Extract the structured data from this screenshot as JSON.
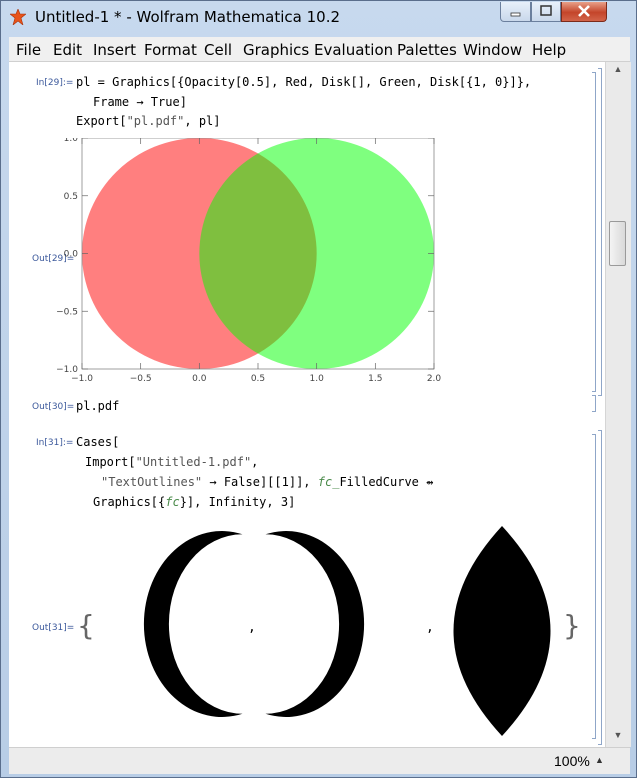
{
  "window": {
    "title": "Untitled-1 * - Wolfram Mathematica 10.2"
  },
  "menu": [
    "File",
    "Edit",
    "Insert",
    "Format",
    "Cell",
    "Graphics",
    "Evaluation",
    "Palettes",
    "Window",
    "Help"
  ],
  "cells": {
    "in29": {
      "label": "In[29]:=",
      "line1": "pl = Graphics[{Opacity[0.5], Red, Disk[], Green, Disk[{1, 0}]},",
      "line2": "Frame → True]",
      "line3_a": "Export[",
      "line3_str": "\"pl.pdf\"",
      "line3_b": ", pl]"
    },
    "out29": {
      "label": "Out[29]="
    },
    "out30": {
      "label": "Out[30]=",
      "value": "pl.pdf"
    },
    "in31": {
      "label": "In[31]:=",
      "line1": "Cases[",
      "line2_a": "Import[",
      "line2_str": "\"Untitled-1.pdf\"",
      "line2_b": ",",
      "line3_str": "\"TextOutlines\"",
      "line3_b": " → False][[1]], ",
      "line3_pat": "fc_",
      "line3_c": "FilledCurve ⇴",
      "line4_a": "Graphics[{",
      "line4_pat": "fc",
      "line4_b": "}], Infinity, 3]"
    },
    "out31": {
      "label": "Out[31]=",
      "open_brace": "{",
      "close_brace": "}",
      "sep1": ",",
      "sep2": ","
    }
  },
  "plot": {
    "xticks": [
      "−1.0",
      "−0.5",
      "0.0",
      "0.5",
      "1.0",
      "1.5",
      "2.0"
    ],
    "yticks": [
      "1.0",
      "0.5",
      "0.0",
      "−0.5",
      "−1.0"
    ],
    "xrange": [
      -1.0,
      2.0
    ],
    "yrange": [
      -1.0,
      1.0
    ],
    "disks": [
      {
        "name": "red-disk",
        "cx": 0,
        "cy": 0,
        "r": 1,
        "color": "#ff0000",
        "opacity": 0.5
      },
      {
        "name": "green-disk",
        "cx": 1,
        "cy": 0,
        "r": 1,
        "color": "#00ff00",
        "opacity": 0.5
      }
    ]
  },
  "status": {
    "zoom": "100%"
  },
  "colors": {
    "cell_label": "#3d5a9c",
    "bracket": "#8fa6c8"
  }
}
